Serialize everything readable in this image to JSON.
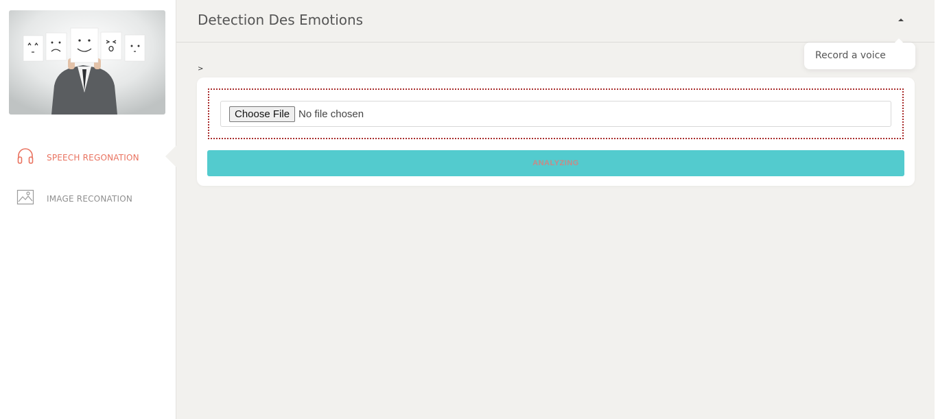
{
  "app": {
    "title": "Detection Des Emotions",
    "logo_icon": "emotion-faces-photo"
  },
  "sidebar": {
    "items": [
      {
        "label": "SPEECH REGONATION",
        "icon": "headphones-icon",
        "active": true,
        "color": "#e9725f"
      },
      {
        "label": "IMAGE RECONATION",
        "icon": "image-icon",
        "active": false,
        "color": "#8f8f8f"
      }
    ]
  },
  "header": {
    "menu": {
      "toggle_icon": "caret-up-icon",
      "items": [
        {
          "label": "Record a voice"
        }
      ]
    }
  },
  "main": {
    "stray_text": ">",
    "upload": {
      "button_label": "Choose File",
      "status": "No file chosen",
      "border_color": "#a82a2a"
    },
    "analyze_button": {
      "label": "ANALYZING",
      "color": "#53cbce"
    }
  }
}
